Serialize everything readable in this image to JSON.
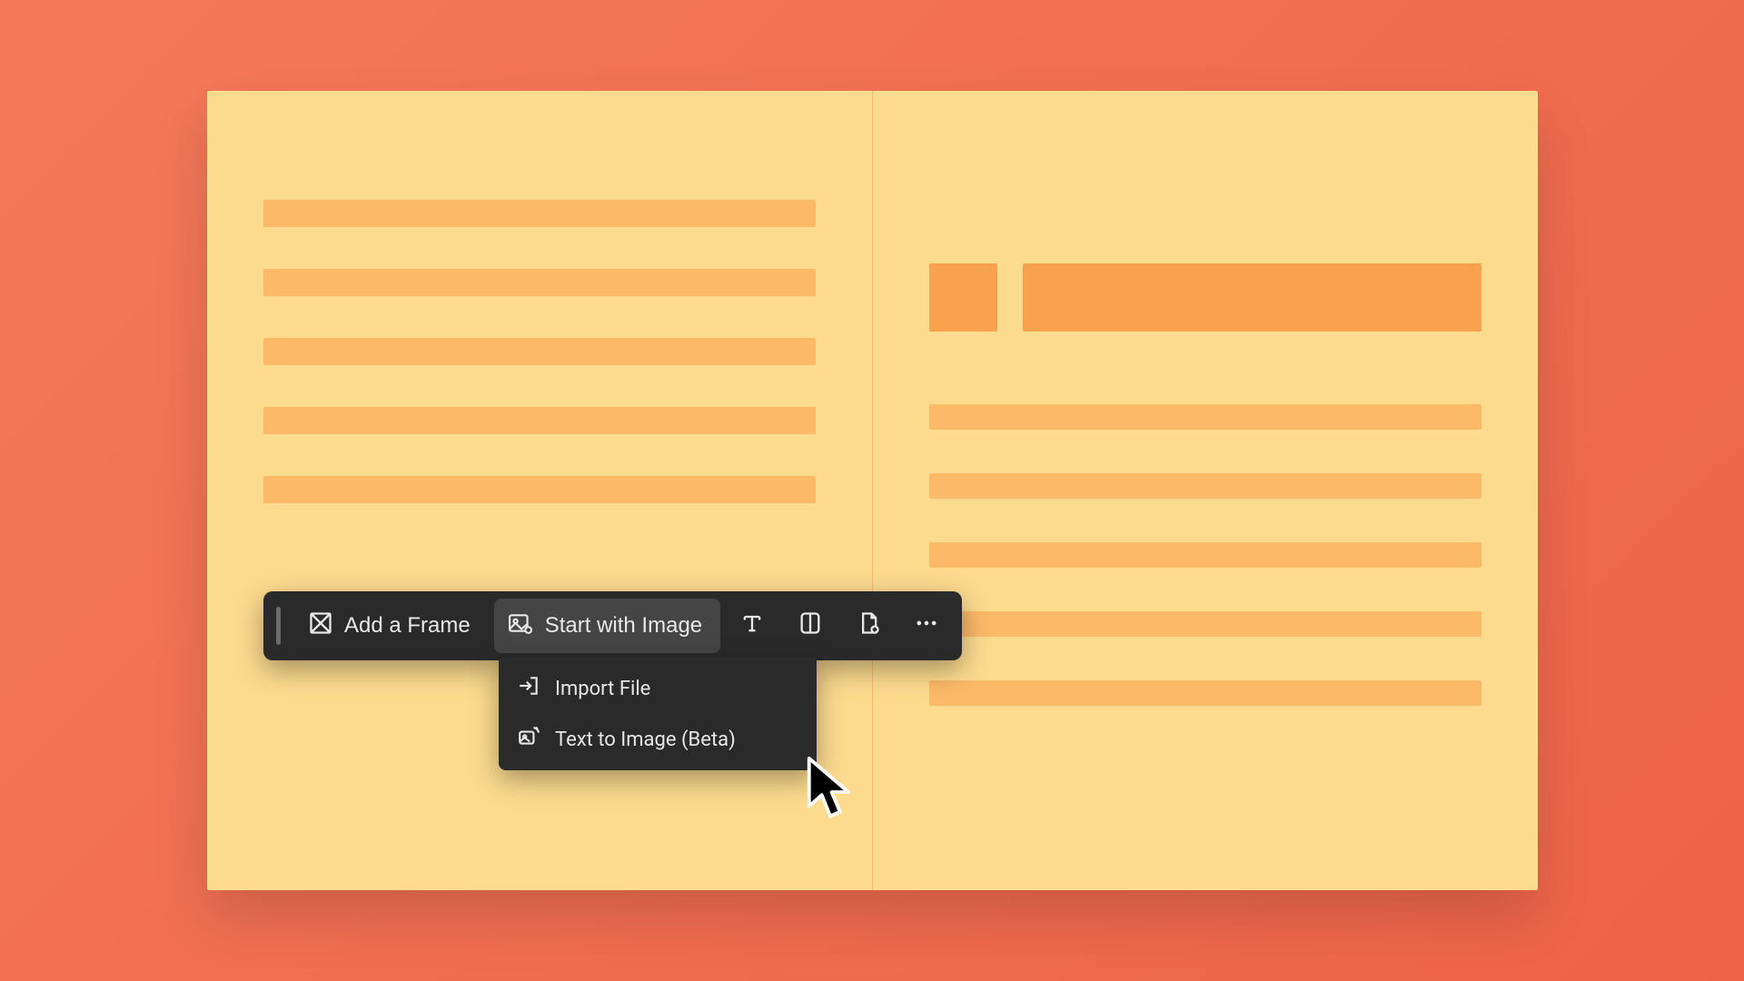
{
  "toolbar": {
    "add_frame_label": "Add a Frame",
    "start_image_label": "Start with Image"
  },
  "dropdown": {
    "import_file_label": "Import File",
    "text_to_image_label": "Text to Image (Beta)"
  },
  "colors": {
    "bg": "#ef6a4d",
    "page": "#fcdb8f",
    "line": "#fcb968",
    "accent": "#f8a24f",
    "toolbar": "#2a2a2a"
  }
}
